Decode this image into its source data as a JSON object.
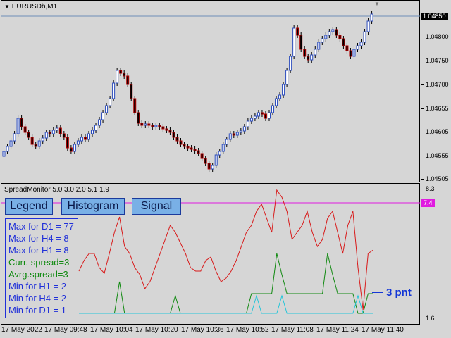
{
  "main_chart": {
    "title": "EURUSDb,M1",
    "price_ticks": [
      "1.04850",
      "1.04800",
      "1.04750",
      "1.04700",
      "1.04655",
      "1.04605",
      "1.04555",
      "1.04505"
    ],
    "current_price": "1.04850",
    "colors": {
      "bull_wick": "#000000",
      "bear": "#b20000",
      "bull": "#2a4bbd",
      "doji": "#1fa81f",
      "price_line": "#6e8fb8"
    }
  },
  "indicator": {
    "title": "SpreadMonitor 5.0 3.0 2.0 5.1 1.9",
    "scale_top": "8.3",
    "scale_bottom": "1.6",
    "level_label": "7.4",
    "buttons": {
      "legend": "Legend",
      "histogram": "Histogram",
      "signal": "Signal"
    },
    "stats": [
      {
        "text": "Max for D1 = 77",
        "color": "#1f2fd9"
      },
      {
        "text": "Max for H4 = 8",
        "color": "#1f2fd9"
      },
      {
        "text": "Max for H1 = 8",
        "color": "#1f2fd9"
      },
      {
        "text": "Curr. spread=3",
        "color": "#0f8a0f"
      },
      {
        "text": "Avrg.spread=3",
        "color": "#0f8a0f"
      },
      {
        "text": "Min for H1 = 2",
        "color": "#1f2fd9"
      },
      {
        "text": "Min for H4 = 2",
        "color": "#1f2fd9"
      },
      {
        "text": "Min for D1 = 1",
        "color": "#1f2fd9"
      }
    ],
    "current_label": "3 pnt",
    "colors": {
      "max": "#d81a1a",
      "avg": "#118a11",
      "min": "#27c6d9",
      "level": "#e01be0",
      "label": "#1437d6"
    }
  },
  "time_axis": [
    "17 May 2022",
    "17 May 09:48",
    "17 May 10:04",
    "17 May 10:20",
    "17 May 10:36",
    "17 May 10:52",
    "17 May 11:08",
    "17 May 11:24",
    "17 May 11:40"
  ]
}
